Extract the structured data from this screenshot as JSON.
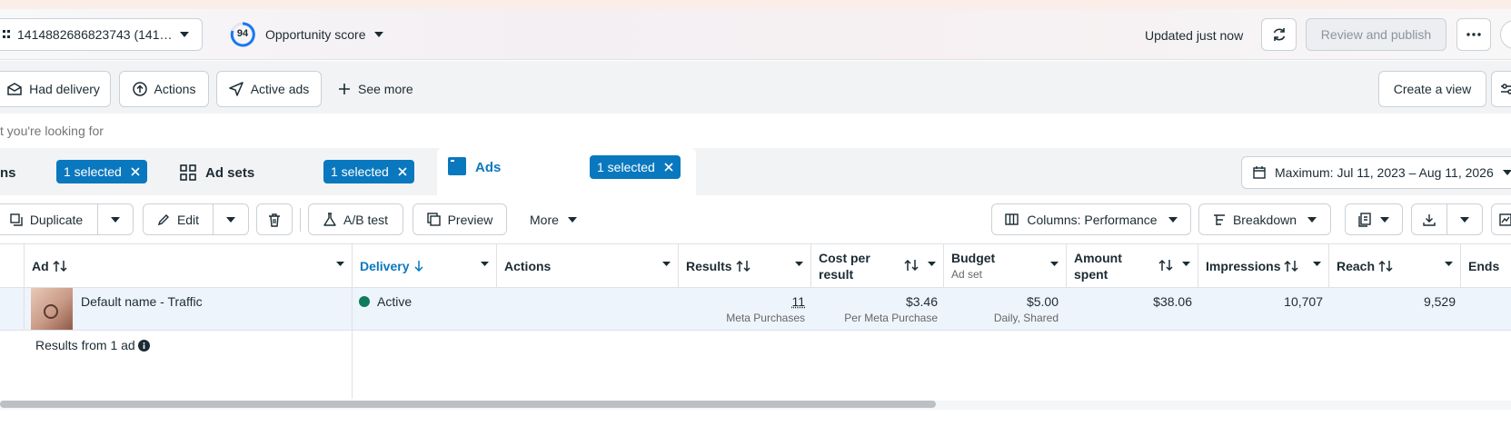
{
  "header": {
    "account_id": "1414882686823743 (141…",
    "opportunity_score": "94",
    "opportunity_label": "Opportunity score",
    "updated_text": "Updated just now",
    "review_publish": "Review and publish"
  },
  "filters": {
    "had_delivery": "Had delivery",
    "actions": "Actions",
    "active_ads": "Active ads",
    "see_more": "See more",
    "create_view": "Create a view"
  },
  "search": {
    "placeholder": "t you're looking for"
  },
  "tabs": {
    "campaigns_label": "ns",
    "campaigns_chip": "1 selected",
    "adsets_label": "Ad sets",
    "adsets_chip": "1 selected",
    "ads_label": "Ads",
    "ads_chip": "1 selected",
    "date_range": "Maximum: Jul 11, 2023 – Aug 11, 2026"
  },
  "toolbar": {
    "duplicate": "Duplicate",
    "edit": "Edit",
    "ab_test": "A/B test",
    "preview": "Preview",
    "more": "More",
    "columns": "Columns: Performance",
    "breakdown": "Breakdown"
  },
  "table": {
    "headers": {
      "ad": "Ad",
      "delivery": "Delivery",
      "actions": "Actions",
      "results": "Results",
      "cost_per_result_1": "Cost per",
      "cost_per_result_2": "result",
      "budget": "Budget",
      "budget_sub": "Ad set",
      "amount_spent_1": "Amount",
      "amount_spent_2": "spent",
      "impressions": "Impressions",
      "reach": "Reach",
      "ends": "Ends"
    },
    "row": {
      "ad_name": "Default name - Traffic",
      "delivery": "Active",
      "results": "11",
      "results_sub": "Meta Purchases",
      "cost_per_result": "$3.46",
      "cost_per_result_sub": "Per Meta Purchase",
      "budget": "$5.00",
      "budget_sub": "Daily, Shared",
      "amount_spent": "$38.06",
      "impressions": "10,707",
      "reach": "9,529"
    },
    "footer": "Results from 1 ad"
  },
  "colors": {
    "accent": "#0a78be",
    "active_dot": "#0f7a5c",
    "score_ring": "#1877f2"
  }
}
